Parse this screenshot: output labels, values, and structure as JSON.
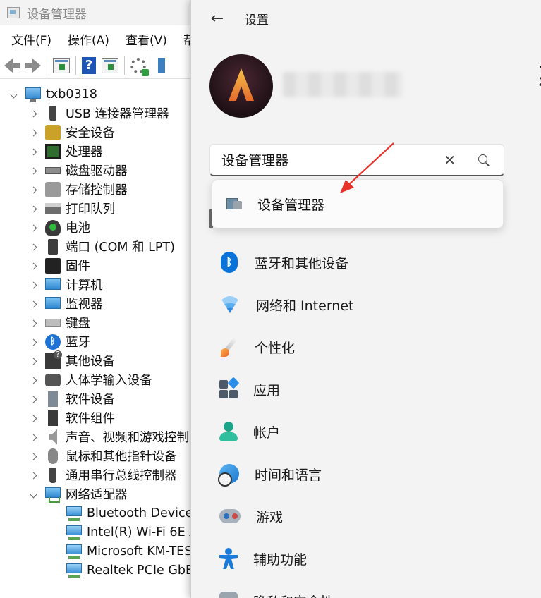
{
  "device_manager": {
    "title": "设备管理器",
    "menu": [
      "文件(F)",
      "操作(A)",
      "查看(V)",
      "帮"
    ],
    "tree": {
      "root": "txb0318",
      "categories": [
        {
          "label": "USB 连接器管理器",
          "icon": "usb-icon"
        },
        {
          "label": "安全设备",
          "icon": "security-device-icon"
        },
        {
          "label": "处理器",
          "icon": "processor-icon"
        },
        {
          "label": "磁盘驱动器",
          "icon": "disk-drive-icon"
        },
        {
          "label": "存储控制器",
          "icon": "storage-controller-icon"
        },
        {
          "label": "打印队列",
          "icon": "printer-icon"
        },
        {
          "label": "电池",
          "icon": "battery-icon"
        },
        {
          "label": "端口 (COM 和 LPT)",
          "icon": "port-icon"
        },
        {
          "label": "固件",
          "icon": "firmware-icon"
        },
        {
          "label": "计算机",
          "icon": "computer-icon"
        },
        {
          "label": "监视器",
          "icon": "monitor-icon"
        },
        {
          "label": "键盘",
          "icon": "keyboard-icon"
        },
        {
          "label": "蓝牙",
          "icon": "bluetooth-icon"
        },
        {
          "label": "其他设备",
          "icon": "other-devices-icon"
        },
        {
          "label": "人体学输入设备",
          "icon": "hid-icon"
        },
        {
          "label": "软件设备",
          "icon": "software-device-icon"
        },
        {
          "label": "软件组件",
          "icon": "software-component-icon"
        },
        {
          "label": "声音、视频和游戏控制",
          "icon": "sound-icon"
        },
        {
          "label": "鼠标和其他指针设备",
          "icon": "mouse-icon"
        },
        {
          "label": "通用串行总线控制器",
          "icon": "usb-controller-icon"
        },
        {
          "label": "网络适配器",
          "icon": "network-adapter-icon",
          "expanded": true
        }
      ],
      "network_adapters": [
        "Bluetooth Device",
        "Intel(R) Wi-Fi 6E A",
        "Microsoft KM-TES",
        "Realtek PCIe GbE"
      ]
    }
  },
  "settings": {
    "title": "设置",
    "search": {
      "value": "设备管理器",
      "suggestion": "设备管理器"
    },
    "nav": [
      {
        "label": "蓝牙和其他设备",
        "icon": "bluetooth-icon"
      },
      {
        "label": "网络和 Internet",
        "icon": "wifi-icon"
      },
      {
        "label": "个性化",
        "icon": "paintbrush-icon"
      },
      {
        "label": "应用",
        "icon": "apps-icon"
      },
      {
        "label": "帐户",
        "icon": "account-icon"
      },
      {
        "label": "时间和语言",
        "icon": "time-language-icon"
      },
      {
        "label": "游戏",
        "icon": "gaming-icon"
      },
      {
        "label": "辅助功能",
        "icon": "accessibility-icon"
      },
      {
        "label": "隐私和安全性",
        "icon": "privacy-shield-icon"
      }
    ],
    "right_glimpse": "系"
  },
  "annotation_color": "#e8322a"
}
